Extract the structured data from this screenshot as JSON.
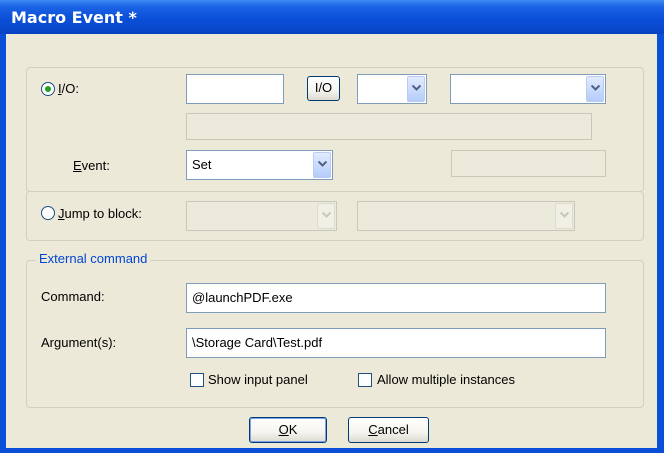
{
  "window": {
    "title": "Macro Event *"
  },
  "io_group": {
    "radio_label": "I/O:",
    "radio_mnemonic": "I",
    "io_input_value": "",
    "io_button_label": "I/O",
    "io_type_value": "",
    "io_target_value": "",
    "io_description": "",
    "event_label": "Event:",
    "event_mnemonic": "E",
    "event_value": "Set",
    "event_param_value": ""
  },
  "jump_group": {
    "radio_label": "Jump to block:",
    "radio_mnemonic": "J",
    "block_value": "",
    "block_target_value": ""
  },
  "external_command": {
    "legend": "External command",
    "command_label": "Command:",
    "command_value": "@launchPDF.exe",
    "arguments_label": "Argument(s):",
    "arguments_value": "\\Storage Card\\Test.pdf",
    "show_input_panel_label": "Show input panel",
    "show_input_panel_checked": false,
    "allow_multiple_label": "Allow multiple instances",
    "allow_multiple_checked": false
  },
  "buttons": {
    "ok_label": "OK",
    "ok_mnemonic": "O",
    "cancel_label": "Cancel",
    "cancel_mnemonic": "C"
  },
  "selected_radio": "io",
  "colors": {
    "title_bar": "#0a4fd8",
    "dialog_bg": "#ece9d8",
    "legend_text": "#0046d5",
    "radio_dot": "#21a121"
  }
}
